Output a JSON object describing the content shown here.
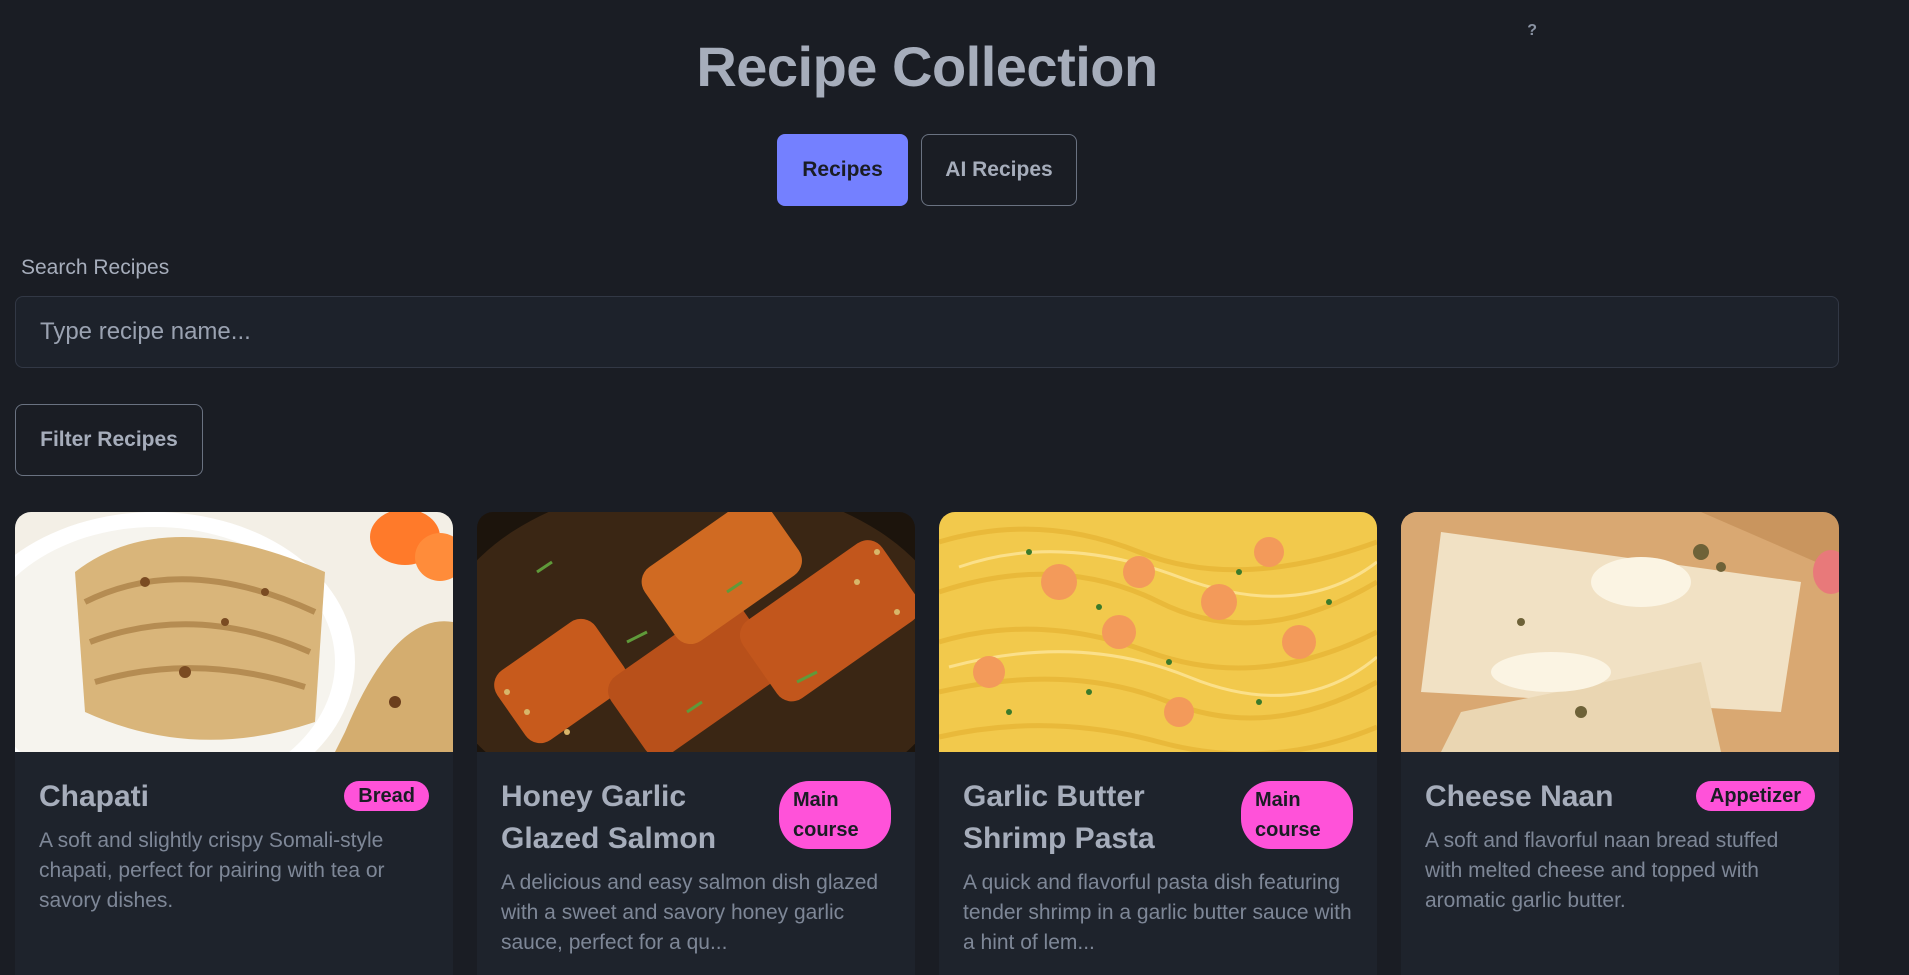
{
  "header": {
    "help_label": "?",
    "title": "Recipe Collection",
    "tabs": [
      {
        "label": "Recipes",
        "active": true
      },
      {
        "label": "AI Recipes",
        "active": false
      }
    ]
  },
  "search": {
    "label": "Search Recipes",
    "placeholder": "Type recipe name...",
    "value": ""
  },
  "filter": {
    "label": "Filter Recipes"
  },
  "recipes": [
    {
      "title": "Chapati",
      "category": "Bread",
      "description": "A soft and slightly crispy Somali-style chapati, perfect for pairing with tea or savory dishes.",
      "image": "chapati-photo"
    },
    {
      "title": "Honey Garlic Glazed Salmon",
      "category": "Main course",
      "description": "A delicious and easy salmon dish glazed with a sweet and savory honey garlic sauce, perfect for a qu...",
      "image": "salmon-photo"
    },
    {
      "title": "Garlic Butter Shrimp Pasta",
      "category": "Main course",
      "description": "A quick and flavorful pasta dish featuring tender shrimp in a garlic butter sauce with a hint of lem...",
      "image": "shrimp-pasta-photo"
    },
    {
      "title": "Cheese Naan",
      "category": "Appetizer",
      "description": "A soft and flavorful naan bread stuffed with melted cheese and topped with aromatic garlic butter.",
      "image": "cheese-naan-photo"
    }
  ],
  "colors": {
    "background": "#1a1d24",
    "primary": "#7480ff",
    "badge": "#ff52d9",
    "card": "#1e232c"
  }
}
